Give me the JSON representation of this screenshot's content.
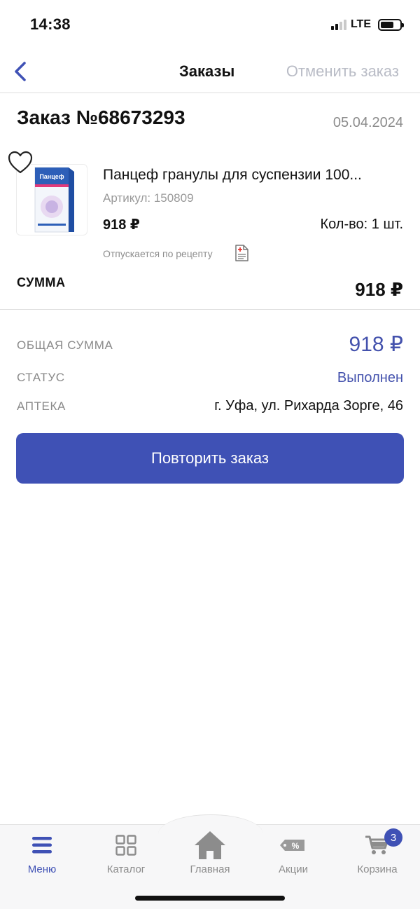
{
  "status_bar": {
    "time": "14:38",
    "network": "LTE"
  },
  "nav": {
    "title": "Заказы",
    "cancel_label": "Отменить заказ"
  },
  "order": {
    "number": "Заказ №68673293",
    "date": "05.04.2024"
  },
  "product": {
    "name": "Панцеф гранулы для суспензии 100...",
    "article": "Артикул: 150809",
    "price": "918 ₽",
    "quantity": "Кол-во: 1 шт.",
    "prescription_note": "Отпускается по рецепту",
    "image_brand": "Панцеф"
  },
  "summary": {
    "label": "СУММА",
    "value": "918 ₽"
  },
  "details": {
    "total_label": "ОБЩАЯ СУММА",
    "total_value": "918 ₽",
    "status_label": "СТАТУС",
    "status_value": "Выполнен",
    "pharmacy_label": "АПТЕКА",
    "pharmacy_value": "г. Уфа, ул. Рихарда Зорге, 46"
  },
  "repeat_button": "Повторить заказ",
  "tabbar": {
    "items": [
      {
        "label": "Меню",
        "icon": "menu-icon",
        "active": true
      },
      {
        "label": "Каталог",
        "icon": "grid-icon",
        "active": false
      },
      {
        "label": "Главная",
        "icon": "home-icon",
        "active": false
      },
      {
        "label": "Акции",
        "icon": "sale-tag-icon",
        "active": false
      },
      {
        "label": "Корзина",
        "icon": "cart-icon",
        "active": false,
        "badge": "3"
      }
    ]
  },
  "colors": {
    "accent": "#3f51b5",
    "accent_text": "#4452ad",
    "muted": "#8a8a8a"
  }
}
